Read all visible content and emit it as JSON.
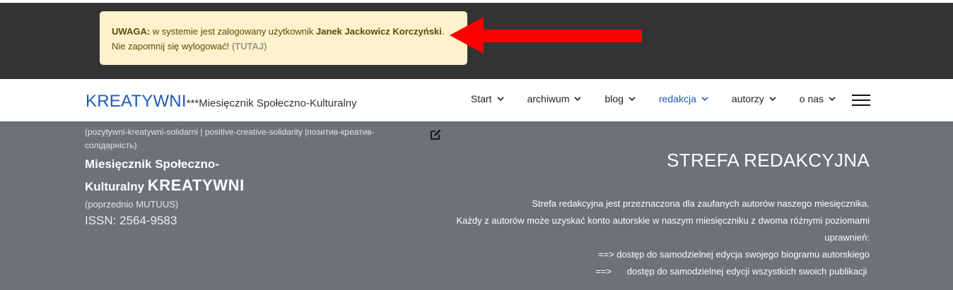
{
  "alert": {
    "label": "UWAGA:",
    "text1": "w systemie jest zalogowany użytkownik",
    "user_name": "Janek Jackowicz Korczyński",
    "text2": ". Nie zapomnij się wylogować!",
    "link": "(TUTAJ)"
  },
  "brand": {
    "name": "KREATYWNI",
    "subtitle": "***Miesięcznik Społeczno-Kulturalny"
  },
  "nav": {
    "items": [
      {
        "label": "Start"
      },
      {
        "label": "archiwum"
      },
      {
        "label": "blog"
      },
      {
        "label": "redakcja",
        "active": true
      },
      {
        "label": "autorzy"
      },
      {
        "label": "o nas"
      }
    ]
  },
  "left": {
    "slogan": "(pozytywni-kreatywni-solidarni | positive-creative-solidarity |позитив-креатив-солідарність)",
    "mag_line1": "Miesięcznik Społeczno-",
    "mag_line2": "Kulturalny",
    "mag_name": "KREATYWNI",
    "previously": "(poprzednio MUTUUS)",
    "issn": "ISSN: 2564-9583"
  },
  "zone": {
    "title": "STREFA REDAKCYJNA",
    "lines": [
      "Strefa redakcyjna jest przeznaczona dla zaufanych autorów naszego miesięcznika.",
      "Każdy z autorów może uzyskać konto autorskie w naszym miesięczniku z dwoma różnymi poziomami",
      "uprawnień:",
      "==> dostęp do samodzielnej edycja swojego biogramu autorskiego",
      "==>      dostęp do samodzielnej edycji wszystkich swoich publikacji "
    ]
  },
  "colors": {
    "accent": "#1e5ab8",
    "arrow": "#ff0000",
    "alert_bg": "#fdf2cc",
    "main_bg": "#6c7275"
  }
}
